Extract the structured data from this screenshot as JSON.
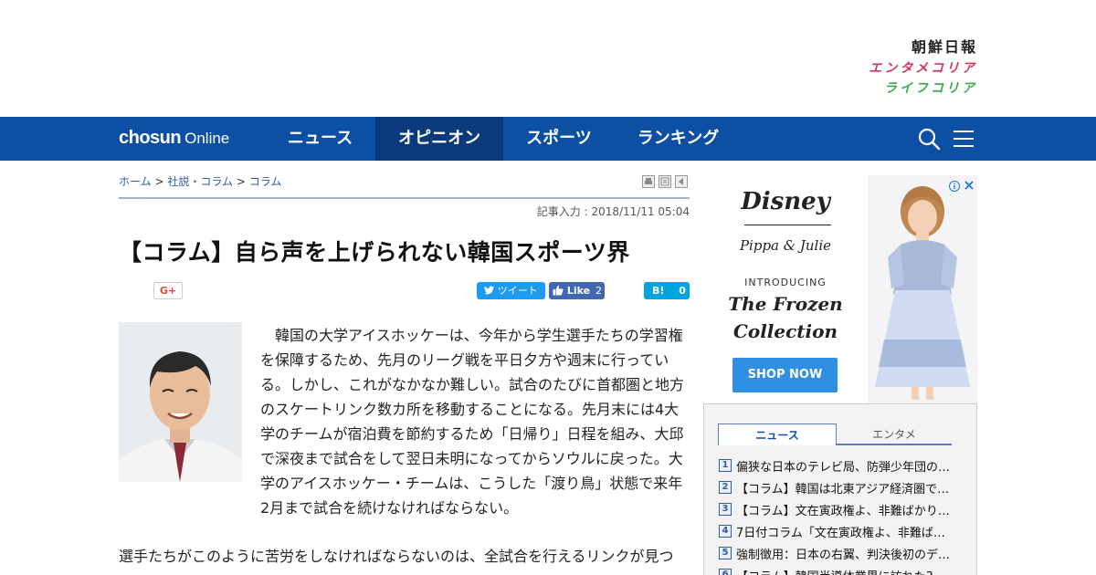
{
  "brands": {
    "chosun_ilbo": "朝鮮日報",
    "entame_korea": "エンタメコリア",
    "life_korea": "ライフコリア"
  },
  "nav": {
    "logo_bold": "chosun",
    "logo_light": "Online",
    "items": [
      "ニュース",
      "オピニオン",
      "スポーツ",
      "ランキング"
    ],
    "active": "オピニオン",
    "accent_color": "#0d4fa3",
    "icons": [
      "search-icon",
      "hamburger-menu-icon"
    ]
  },
  "breadcrumb": {
    "home": "ホーム",
    "sep": ">",
    "section": "社説・コラム",
    "current": "コラム"
  },
  "article": {
    "timestamp": "記事入力 : 2018/11/11 05:04",
    "title": "【コラム】自ら声を上げられない韓国スポーツ界",
    "paragraph1": "韓国の大学アイスホッケーは、今年から学生選手たちの学習権を保障するため、先月のリーグ戦を平日夕方や週末に行っている。しかし、これがなかなか難しい。試合のたびに首都圏と地方のスケートリンク数カ所を移動することになる。先月末には4大学のチームが宿泊費を節約するため「日帰り」日程を組み、大邱で深夜まで試合をして翌日未明になってからソウルに戻った。大学のアイスホッケー・チームは、こうした「渡り鳥」状態で来年2月まで試合を続けなければならない。",
    "paragraph2": "選手たちがこのように苦労をしなければならないのは、全試合を行えるリンクが見つ"
  },
  "social": {
    "gplus": "G+",
    "tweet": "ツイート",
    "like": "Like",
    "like_count": "2",
    "hatena": "B!",
    "hatena_count": "0"
  },
  "ad": {
    "brand": "Disney",
    "sub_brand": "Pippa & Julie",
    "introducing": "INTRODUCING",
    "collection_line1": "The Frozen",
    "collection_line2": "Collection",
    "cta": "SHOP NOW",
    "cta_color": "#2f8fe0"
  },
  "ranking": {
    "tabs": [
      "ニュース",
      "エンタメ"
    ],
    "active_tab": "ニュース",
    "items": [
      {
        "num": "1",
        "title": "偏狭な日本のテレビ局、防弾少年団の…"
      },
      {
        "num": "2",
        "title": "【コラム】韓国は北東アジア経済圏で…"
      },
      {
        "num": "3",
        "title": "【コラム】文在寅政権よ、非難ばかり…"
      },
      {
        "num": "4",
        "title": "7日付コラム「文在寅政権よ、非難ば…"
      },
      {
        "num": "5",
        "title": "強制徴用：日本の右翼、判決後初のデ…"
      },
      {
        "num": "6",
        "title": "【コラム】韓国半導体業界に訪れた3…"
      }
    ]
  }
}
